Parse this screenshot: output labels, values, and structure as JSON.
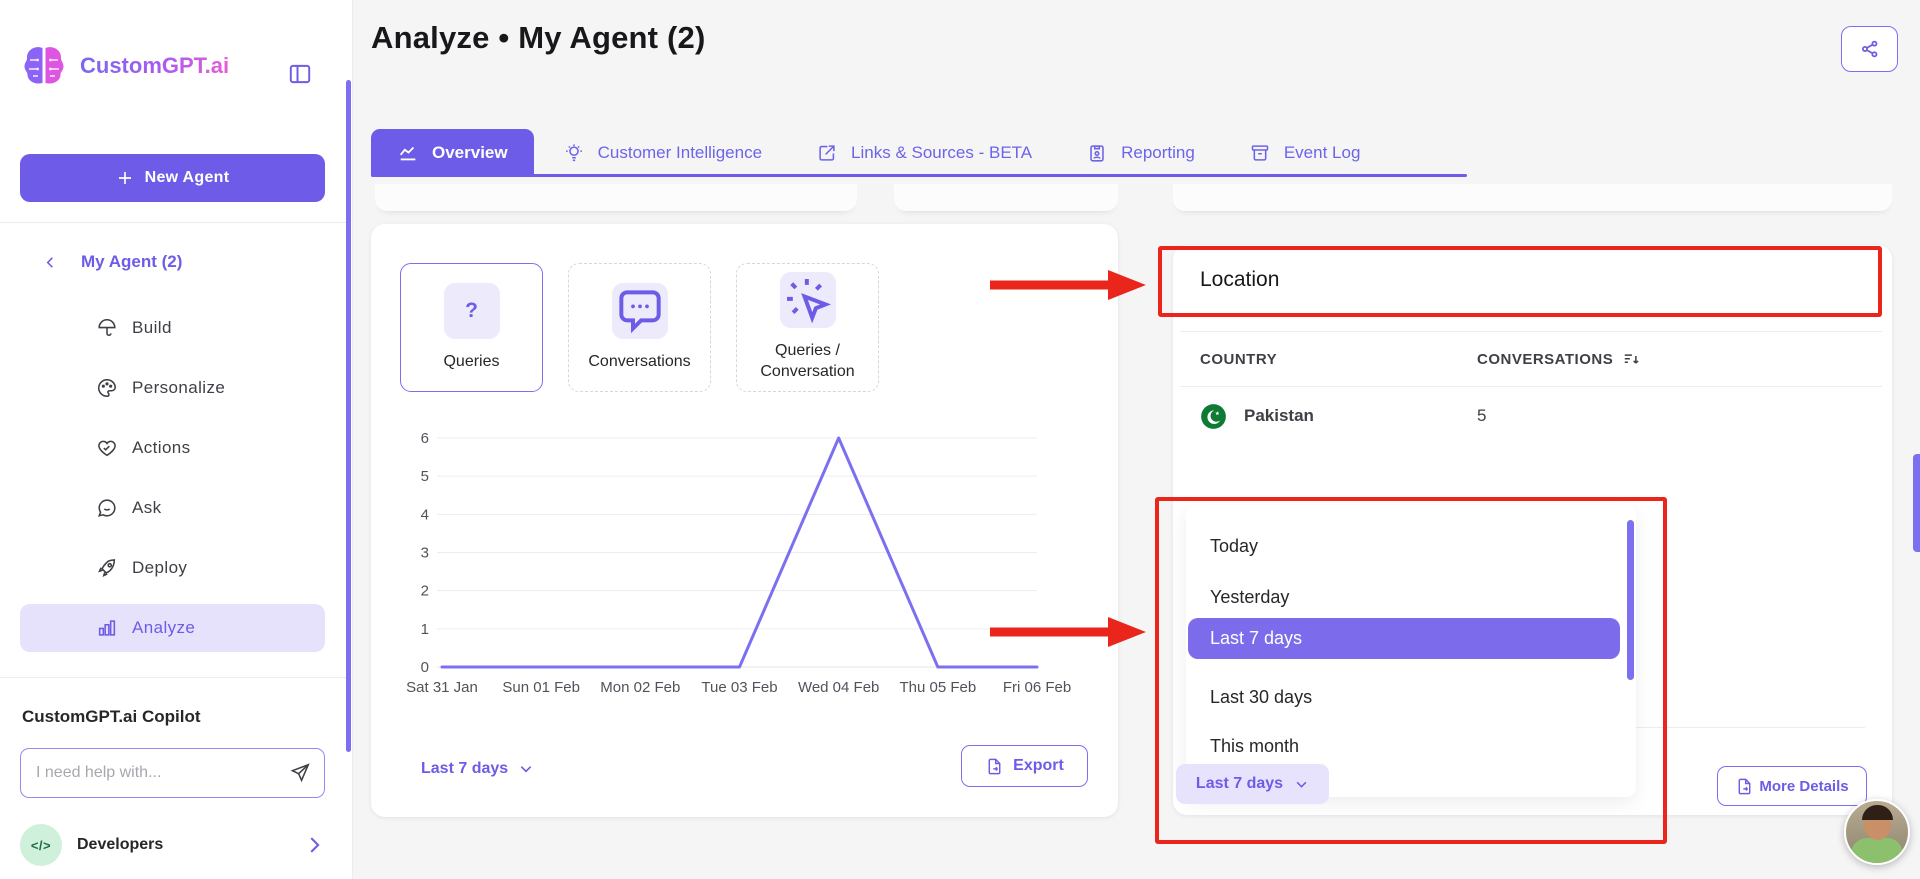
{
  "brand": {
    "name": "CustomGPT.ai"
  },
  "sidebar": {
    "new_agent_label": "New Agent",
    "back_label": "My Agent (2)",
    "items": [
      {
        "label": "Build",
        "icon": "build-icon",
        "active": false
      },
      {
        "label": "Personalize",
        "icon": "personalize-icon",
        "active": false
      },
      {
        "label": "Actions",
        "icon": "actions-icon",
        "active": false
      },
      {
        "label": "Ask",
        "icon": "ask-icon",
        "active": false
      },
      {
        "label": "Deploy",
        "icon": "deploy-icon",
        "active": false
      },
      {
        "label": "Analyze",
        "icon": "analyze-icon",
        "active": true
      }
    ],
    "copilot_title": "CustomGPT.ai Copilot",
    "copilot_placeholder": "I need help with...",
    "developers_label": "Developers",
    "developers_icon": "code-icon"
  },
  "header": {
    "title": "Analyze • My Agent (2)",
    "share_icon": "share-icon"
  },
  "tabs": [
    {
      "label": "Overview",
      "icon": "chart-line-icon",
      "active": true
    },
    {
      "label": "Customer Intelligence",
      "icon": "insight-icon",
      "active": false
    },
    {
      "label": "Links & Sources - BETA",
      "icon": "link-out-icon",
      "active": false
    },
    {
      "label": "Reporting",
      "icon": "report-icon",
      "active": false
    },
    {
      "label": "Event Log",
      "icon": "event-log-icon",
      "active": false
    }
  ],
  "chart_card": {
    "metric_toggles": [
      {
        "label": "Queries",
        "icon": "question-icon",
        "active": true
      },
      {
        "label": "Conversations",
        "icon": "chat-bubble-icon",
        "active": false
      },
      {
        "label": "Queries / Conversation",
        "icon": "click-icon",
        "active": false
      }
    ],
    "range_label": "Last 7 days",
    "export_label": "Export"
  },
  "chart_data": {
    "type": "line",
    "title": "Queries over time",
    "x": [
      "Sat 31 Jan",
      "Sun 01 Feb",
      "Mon 02 Feb",
      "Tue 03 Feb",
      "Wed 04 Feb",
      "Thu 05 Feb",
      "Fri 06 Feb"
    ],
    "series": [
      {
        "name": "Queries",
        "values": [
          0,
          0,
          0,
          0,
          6,
          0,
          0
        ]
      }
    ],
    "ylim": [
      0,
      6
    ],
    "yticks": [
      0,
      1,
      2,
      3,
      4,
      5,
      6
    ],
    "grid": true,
    "legend": "none",
    "line_color": "#7b70f0"
  },
  "location_card": {
    "title": "Location",
    "table": {
      "columns": [
        "COUNTRY",
        "CONVERSATIONS"
      ],
      "sort_icon": "sort-desc-icon",
      "rows": [
        {
          "country": "Pakistan",
          "flag": "pakistan-flag",
          "conversations": "5"
        }
      ]
    },
    "range_menu_items": [
      {
        "label": "Today",
        "selected": false
      },
      {
        "label": "Yesterday",
        "selected": false
      },
      {
        "label": "Last 7 days",
        "selected": true
      },
      {
        "label": "Last 30 days",
        "selected": false
      },
      {
        "label": "This month",
        "selected": false
      }
    ],
    "range_label": "Last 7 days",
    "more_details_label": "More Details"
  },
  "colors": {
    "accent": "#6c5ce7",
    "accent_light": "#e7e3fc",
    "annotation_red": "#e9251c",
    "flag_green": "#0e7a34",
    "scrollbar": "#7c6ff0"
  }
}
